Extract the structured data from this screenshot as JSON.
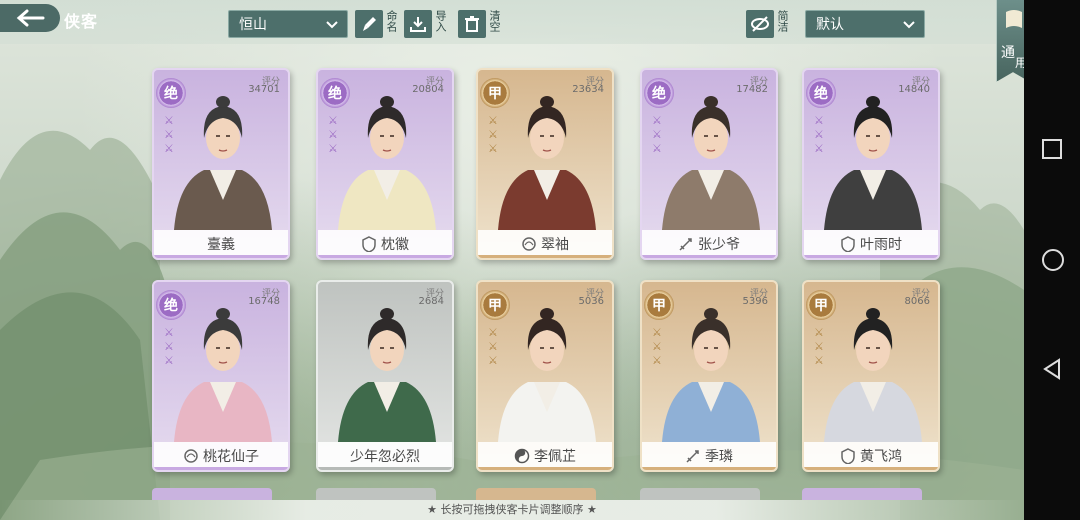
{
  "header": {
    "title": "侠客",
    "sect_filter": "恒山",
    "rename_label": "命名",
    "import_label": "导入",
    "clear_label": "清空",
    "simple_label": "简洁",
    "sort_select": "默认",
    "right_tab_label_1": "通",
    "right_tab_label_2": "用"
  },
  "score_label": "评分",
  "cards": [
    {
      "name": "臺義",
      "grade": "绝",
      "score": "34701",
      "rarity": "jue",
      "sect_icon": "none"
    },
    {
      "name": "枕徽",
      "grade": "绝",
      "score": "20804",
      "rarity": "jue",
      "sect_icon": "shield-icon"
    },
    {
      "name": "翠袖",
      "grade": "甲",
      "score": "23634",
      "rarity": "jia",
      "sect_icon": "lotus-icon"
    },
    {
      "name": "张少爷",
      "grade": "绝",
      "score": "17482",
      "rarity": "jue",
      "sect_icon": "sword-icon"
    },
    {
      "name": "叶雨时",
      "grade": "绝",
      "score": "14840",
      "rarity": "jue",
      "sect_icon": "shield-icon"
    },
    {
      "name": "桃花仙子",
      "grade": "绝",
      "score": "16748",
      "rarity": "jue",
      "sect_icon": "lotus-icon"
    },
    {
      "name": "少年忽必烈",
      "grade": "",
      "score": "2684",
      "rarity": "yi",
      "sect_icon": "none"
    },
    {
      "name": "李佩芷",
      "grade": "甲",
      "score": "5036",
      "rarity": "jia",
      "sect_icon": "taiji-icon"
    },
    {
      "name": "季璘",
      "grade": "甲",
      "score": "5396",
      "rarity": "jia",
      "sect_icon": "sword-icon"
    },
    {
      "name": "黄飞鸿",
      "grade": "甲",
      "score": "8066",
      "rarity": "jia",
      "sect_icon": "shield-icon"
    }
  ],
  "hint_text": "★ 长按可拖拽侠客卡片调整顺序 ★",
  "colors": {
    "jue_accent": "#9c6cc4",
    "jia_accent": "#a97b3e",
    "toolbar": "#4d6f6b"
  }
}
